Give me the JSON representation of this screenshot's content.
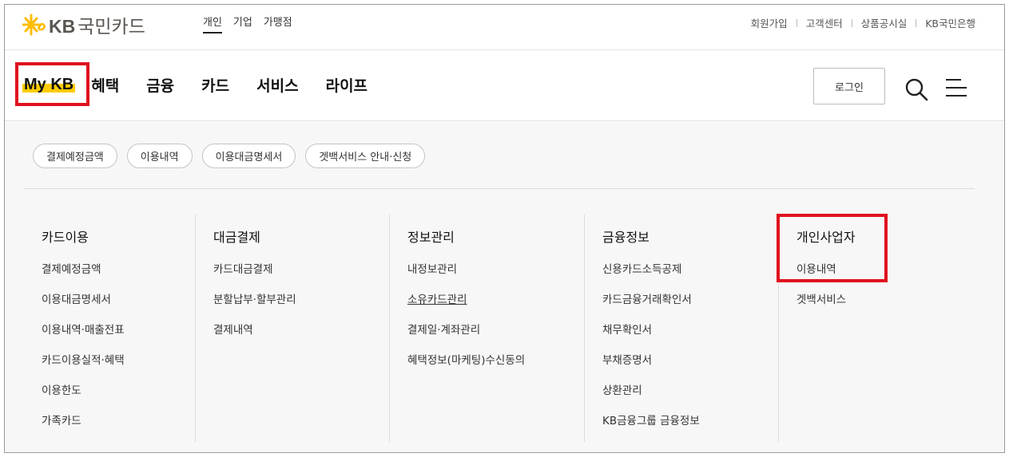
{
  "brand": {
    "name": "KB",
    "name_kr": "국민카드",
    "accent": "#ffcc00",
    "highlight_box": "#e0101e"
  },
  "segments": [
    "개인",
    "기업",
    "가맹점"
  ],
  "utility_links": [
    "회원가입",
    "고객센터",
    "상품공시실",
    "KB국민은행"
  ],
  "nav": {
    "items": [
      "My KB",
      "혜택",
      "금융",
      "카드",
      "서비스",
      "라이프"
    ],
    "login_label": "로그인",
    "search_icon": "search-icon",
    "menu_icon": "hamburger-menu-icon"
  },
  "chips": [
    "결제예정금액",
    "이용내역",
    "이용대금명세서",
    "겟백서비스 안내·신청"
  ],
  "columns": [
    {
      "title": "카드이용",
      "items": [
        "결제예정금액",
        "이용대금명세서",
        "이용내역·매출전표",
        "카드이용실적·혜택",
        "이용한도",
        "가족카드"
      ]
    },
    {
      "title": "대금결제",
      "items": [
        "카드대금결제",
        "분할납부·할부관리",
        "결제내역"
      ]
    },
    {
      "title": "정보관리",
      "items": [
        "내정보관리",
        "소유카드관리",
        "결제일·계좌관리",
        "혜택정보(마케팅)수신동의"
      ]
    },
    {
      "title": "금융정보",
      "items": [
        "신용카드소득공제",
        "카드금융거래확인서",
        "채무확인서",
        "부채증명서",
        "상환관리",
        "KB금융그룹 금융정보"
      ]
    },
    {
      "title": "개인사업자",
      "items": [
        "이용내역",
        "겟백서비스"
      ]
    }
  ]
}
